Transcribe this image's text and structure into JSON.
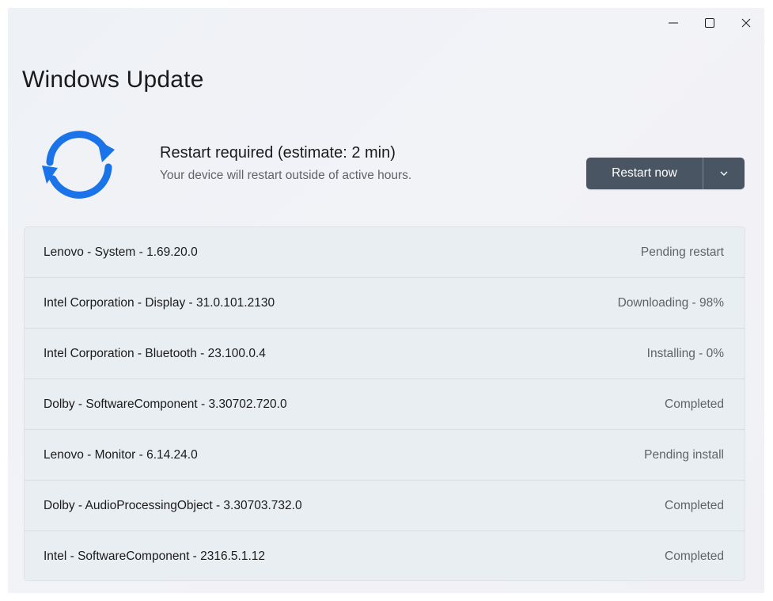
{
  "window": {
    "title": "Windows Update",
    "controls": [
      "minimize",
      "maximize",
      "close"
    ]
  },
  "status": {
    "title": "Restart required (estimate: 2 min)",
    "subtitle": "Your device will restart outside of active hours.",
    "icon": "sync-icon"
  },
  "actions": {
    "restart_label": "Restart now",
    "dropdown_icon": "chevron-down-icon"
  },
  "updates": [
    {
      "name": "Lenovo - System - 1.69.20.0",
      "status": "Pending restart"
    },
    {
      "name": "Intel Corporation - Display - 31.0.101.2130",
      "status": "Downloading - 98%"
    },
    {
      "name": "Intel Corporation - Bluetooth - 23.100.0.4",
      "status": "Installing - 0%"
    },
    {
      "name": "Dolby - SoftwareComponent - 3.30702.720.0",
      "status": "Completed"
    },
    {
      "name": "Lenovo - Monitor - 6.14.24.0",
      "status": "Pending install"
    },
    {
      "name": "Dolby - AudioProcessingObject - 3.30703.732.0",
      "status": "Completed"
    },
    {
      "name": "Intel - SoftwareComponent - 2316.5.1.12",
      "status": "Completed"
    }
  ],
  "colors": {
    "accent_blue": "#1a73e8",
    "button_bg": "#4a5563"
  }
}
